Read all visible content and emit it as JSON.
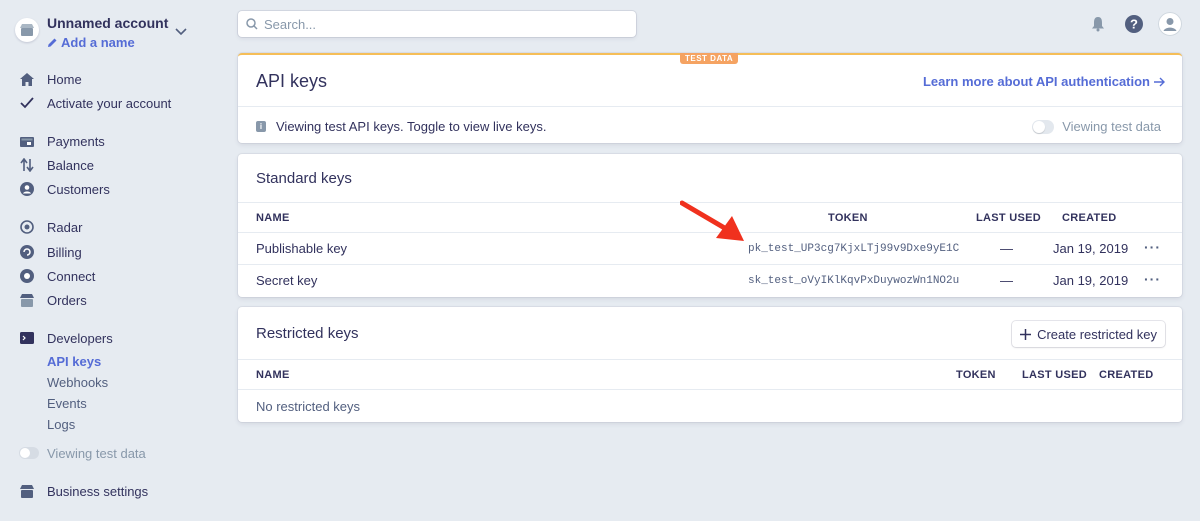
{
  "account": {
    "name": "Unnamed account",
    "add_name": "Add a name"
  },
  "nav": {
    "home": "Home",
    "activate": "Activate your account",
    "payments": "Payments",
    "balance": "Balance",
    "customers": "Customers",
    "radar": "Radar",
    "billing": "Billing",
    "connect": "Connect",
    "orders": "Orders",
    "developers": "Developers",
    "api_keys": "API keys",
    "webhooks": "Webhooks",
    "events": "Events",
    "logs": "Logs",
    "viewing_test": "Viewing test data",
    "business_settings": "Business settings"
  },
  "search": {
    "placeholder": "Search..."
  },
  "api_card": {
    "badge": "TEST DATA",
    "title": "API keys",
    "learn_more": "Learn more about API authentication",
    "info": "Viewing test API keys. Toggle to view live keys.",
    "toggle_label": "Viewing test data"
  },
  "standard_keys": {
    "title": "Standard keys",
    "headers": {
      "name": "NAME",
      "token": "TOKEN",
      "last_used": "LAST USED",
      "created": "CREATED"
    },
    "rows": [
      {
        "name": "Publishable key",
        "token": "pk_test_UP3cg7KjxLTj99v9Dxe9yE1C",
        "last_used": "—",
        "created": "Jan 19, 2019",
        "more": "···"
      },
      {
        "name": "Secret key",
        "token": "sk_test_oVyIKlKqvPxDuywozWn1NO2u",
        "last_used": "—",
        "created": "Jan 19, 2019",
        "more": "···"
      }
    ]
  },
  "restricted_keys": {
    "title": "Restricted keys",
    "create_button": "Create restricted key",
    "headers": {
      "name": "NAME",
      "token": "TOKEN",
      "last_used": "LAST USED",
      "created": "CREATED"
    },
    "empty": "No restricted keys"
  },
  "colors": {
    "accent": "#556cd6",
    "test_badge": "#f5a362",
    "arrow": "#f0311e",
    "background": "#e6ebf1"
  }
}
